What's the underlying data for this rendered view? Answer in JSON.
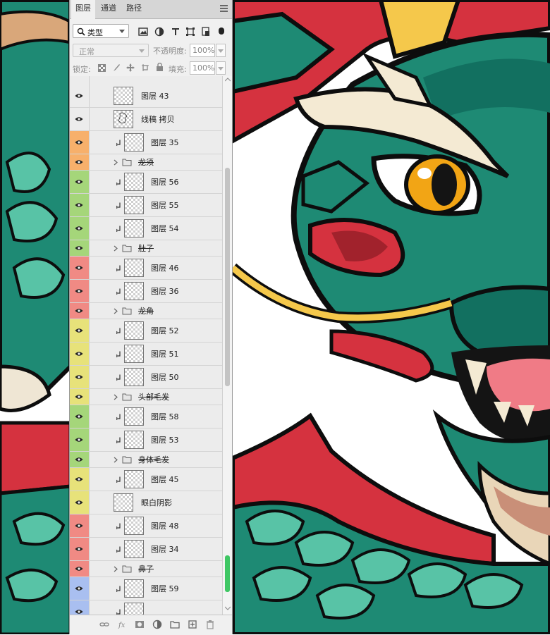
{
  "panel": {
    "tabs": [
      "图层",
      "通道",
      "路径"
    ],
    "filter": {
      "kind_label": "类型"
    },
    "blend_mode": "正常",
    "opacity_label": "不透明度:",
    "opacity_value": "100%",
    "lock_label": "锁定:",
    "fill_label": "填充:",
    "fill_value": "100%"
  },
  "layers": [
    {
      "name": "图层 43",
      "type": "layer",
      "color": "#ececec",
      "clipped": false,
      "thumb": "checker"
    },
    {
      "name": "线稿 拷贝",
      "type": "layer",
      "color": "#ececec",
      "clipped": false,
      "thumb": "sketch"
    },
    {
      "name": "图层 35",
      "type": "layer",
      "color": "#f7b06b",
      "clipped": true,
      "thumb": "checker"
    },
    {
      "name": "龙须",
      "type": "group",
      "color": "#f7b06b"
    },
    {
      "name": "图层 56",
      "type": "layer",
      "color": "#a5d67a",
      "clipped": true,
      "thumb": "checker"
    },
    {
      "name": "图层 55",
      "type": "layer",
      "color": "#a5d67a",
      "clipped": true,
      "thumb": "checker"
    },
    {
      "name": "图层 54",
      "type": "layer",
      "color": "#a5d67a",
      "clipped": true,
      "thumb": "checker"
    },
    {
      "name": "肚子",
      "type": "group",
      "color": "#a5d67a"
    },
    {
      "name": "图层 46",
      "type": "layer",
      "color": "#f08a84",
      "clipped": true,
      "thumb": "checker"
    },
    {
      "name": "图层 36",
      "type": "layer",
      "color": "#f08a84",
      "clipped": true,
      "thumb": "checker"
    },
    {
      "name": "龙角",
      "type": "group",
      "color": "#f08a84"
    },
    {
      "name": "图层 52",
      "type": "layer",
      "color": "#e7e27a",
      "clipped": true,
      "thumb": "checker"
    },
    {
      "name": "图层 51",
      "type": "layer",
      "color": "#e7e27a",
      "clipped": true,
      "thumb": "checker"
    },
    {
      "name": "图层 50",
      "type": "layer",
      "color": "#e7e27a",
      "clipped": true,
      "thumb": "checker"
    },
    {
      "name": "头部毛发",
      "type": "group",
      "color": "#e7e27a"
    },
    {
      "name": "图层 58",
      "type": "layer",
      "color": "#a5d67a",
      "clipped": true,
      "thumb": "checker"
    },
    {
      "name": "图层 53",
      "type": "layer",
      "color": "#a5d67a",
      "clipped": true,
      "thumb": "checker"
    },
    {
      "name": "身体毛发",
      "type": "group",
      "color": "#a5d67a"
    },
    {
      "name": "图层 45",
      "type": "layer",
      "color": "#e7e27a",
      "clipped": true,
      "thumb": "checker"
    },
    {
      "name": "眼白阴影",
      "type": "layer",
      "color": "#e7e27a",
      "clipped": false,
      "thumb": "checker"
    },
    {
      "name": "图层 48",
      "type": "layer",
      "color": "#f08a84",
      "clipped": true,
      "thumb": "checker"
    },
    {
      "name": "图层 34",
      "type": "layer",
      "color": "#f08a84",
      "clipped": true,
      "thumb": "checker"
    },
    {
      "name": "鼻子",
      "type": "group",
      "color": "#f08a84"
    },
    {
      "name": "图层 59",
      "type": "layer",
      "color": "#a9bff0",
      "clipped": true,
      "thumb": "checker"
    },
    {
      "name": "",
      "type": "layer",
      "color": "#a9bff0",
      "clipped": true,
      "thumb": "checker"
    }
  ],
  "colors": {
    "dragon_green": "#1e8a74",
    "dragon_dark": "#0f5a4b",
    "dragon_light": "#58c3a6",
    "dragon_red": "#d5323f",
    "gold": "#f5c84b",
    "cream": "#f4ead3",
    "eye_orange": "#f2a515"
  }
}
